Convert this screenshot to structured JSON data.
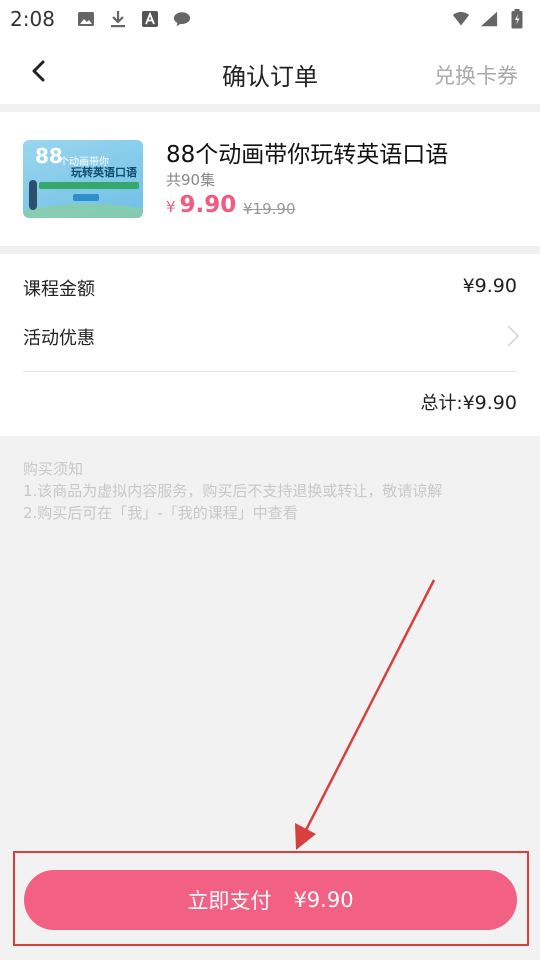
{
  "status_bar": {
    "time": "2:08",
    "icons": [
      "image-icon",
      "download-icon",
      "font-icon",
      "message-icon",
      "wifi-icon",
      "signal-icon",
      "battery-icon"
    ]
  },
  "nav": {
    "title": "确认订单",
    "right_action": "兑换卡券"
  },
  "product": {
    "thumb_badge": "88",
    "thumb_line1": "个动画带你",
    "thumb_line2": "玩转英语口语",
    "title": "88个动画带你玩转英语口语",
    "episodes": "共90集",
    "currency": "¥",
    "price": "9.90",
    "original_price": "¥19.90"
  },
  "details": {
    "course_amount_label": "课程金额",
    "course_amount_value": "¥9.90",
    "promo_label": "活动优惠",
    "total_label": "总计:",
    "total_value": "¥9.90"
  },
  "notice": {
    "title": "购买须知",
    "line1": "1.该商品为虚拟内容服务，购买后不支持退换或转让，敬请谅解",
    "line2": "2.购买后可在「我」-「我的课程」中查看"
  },
  "footer": {
    "pay_label": "立即支付",
    "pay_amount": "¥9.90"
  },
  "colors": {
    "accent": "#f26083",
    "price": "#f25a82",
    "annotation": "#d8403e"
  }
}
